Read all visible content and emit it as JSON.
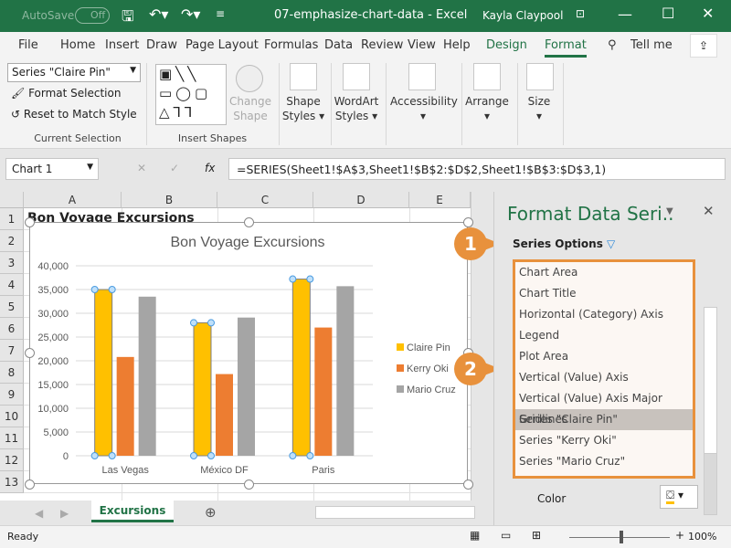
{
  "titlebar": {
    "autosave": "AutoSave",
    "autosave_state": "Off",
    "doc_title": "07-emphasize-chart-data  -  Excel",
    "user": "Kayla Claypool"
  },
  "tabs": [
    {
      "label": "File"
    },
    {
      "label": "Home"
    },
    {
      "label": "Insert"
    },
    {
      "label": "Draw"
    },
    {
      "label": "Page Layout"
    },
    {
      "label": "Formulas"
    },
    {
      "label": "Data"
    },
    {
      "label": "Review"
    },
    {
      "label": "View"
    },
    {
      "label": "Help"
    },
    {
      "label": "Design"
    },
    {
      "label": "Format"
    }
  ],
  "tell_me": "Tell me",
  "ribbon": {
    "selection_value": "Series \"Claire Pin\"",
    "format_selection": "Format Selection",
    "reset_style": "Reset to Match Style",
    "current_selection": "Current Selection",
    "insert_shapes": "Insert Shapes",
    "change_shape": [
      "Change",
      "Shape"
    ],
    "shape_styles": [
      "Shape",
      "Styles"
    ],
    "wordart_styles": [
      "WordArt",
      "Styles"
    ],
    "accessibility": "Accessibility",
    "arrange": "Arrange",
    "size": "Size"
  },
  "formula_bar": {
    "name_box": "Chart 1",
    "fx": "fx",
    "formula": "=SERIES(Sheet1!$A$3,Sheet1!$B$2:$D$2,Sheet1!$B$3:$D$3,1)"
  },
  "sheet": {
    "columns": [
      "A",
      "B",
      "C",
      "D",
      "E"
    ],
    "rows": [
      "1",
      "2",
      "3",
      "4",
      "5",
      "6",
      "7",
      "8",
      "9",
      "10",
      "11",
      "12",
      "13"
    ],
    "a1": "Bon Voyage Excursions"
  },
  "chart_data": {
    "type": "bar",
    "title": "Bon Voyage Excursions",
    "categories": [
      "Las Vegas",
      "México DF",
      "Paris"
    ],
    "ylim": [
      0,
      40000
    ],
    "yticks": [
      "0",
      "5,000",
      "10,000",
      "15,000",
      "20,000",
      "25,000",
      "30,000",
      "35,000",
      "40,000"
    ],
    "grid": true,
    "legend": "right",
    "series": [
      {
        "name": "Claire Pin",
        "color": "#ffc000",
        "values": [
          35000,
          28000,
          37200
        ]
      },
      {
        "name": "Kerry Oki",
        "color": "#ed7d31",
        "values": [
          20800,
          17200,
          27000
        ]
      },
      {
        "name": "Mario Cruz",
        "color": "#a5a5a5",
        "values": [
          33500,
          29100,
          35700
        ]
      }
    ],
    "selected_series": "Claire Pin"
  },
  "pane": {
    "title": "Format Data Seri..",
    "series_options": "Series Options",
    "items": [
      "Chart Area",
      "Chart Title",
      "Horizontal (Category) Axis",
      "Legend",
      "Plot Area",
      "Vertical (Value) Axis",
      "Vertical (Value) Axis Major Gridlines",
      "Series \"Claire Pin\"",
      "Series \"Kerry Oki\"",
      "Series \"Mario Cruz\""
    ],
    "selected_index": 7,
    "color_label": "Color"
  },
  "callouts": [
    "1",
    "2"
  ],
  "sheet_tab": "Excursions",
  "status": {
    "ready": "Ready",
    "zoom": "100%"
  },
  "colors": {
    "excel_green": "#217346",
    "callout": "#e8913c"
  }
}
